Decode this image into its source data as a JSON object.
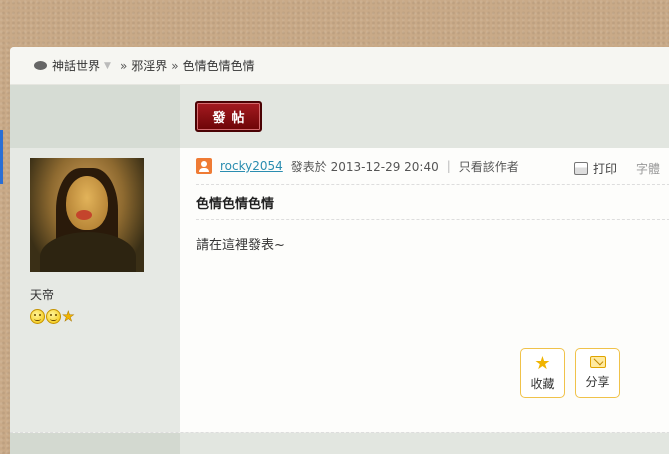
{
  "breadcrumb": {
    "home": "神話世界",
    "sep1": "»",
    "forum": "邪淫界",
    "sep2": "»",
    "thread": "色情色情色情"
  },
  "toolbar": {
    "post_button_label": "發帖"
  },
  "author": {
    "name": "天帝",
    "rank_icons": [
      "smiley-icon",
      "smiley-icon",
      "star-icon"
    ]
  },
  "post": {
    "username": "rocky2054",
    "posted_at": "發表於 2013-12-29 20:40",
    "pipe": "|",
    "only_author": "只看該作者",
    "print_label": "打印",
    "font_size_label": "字體",
    "title": "色情色情色情",
    "body": "請在這裡發表~"
  },
  "actions": {
    "favorite_label": "收藏",
    "share_label": "分享"
  },
  "colors": {
    "accent_blue": "#2a6fd6",
    "post_button": "#8a0c10",
    "username": "#2a8db0",
    "action_border": "#f0c24a"
  }
}
